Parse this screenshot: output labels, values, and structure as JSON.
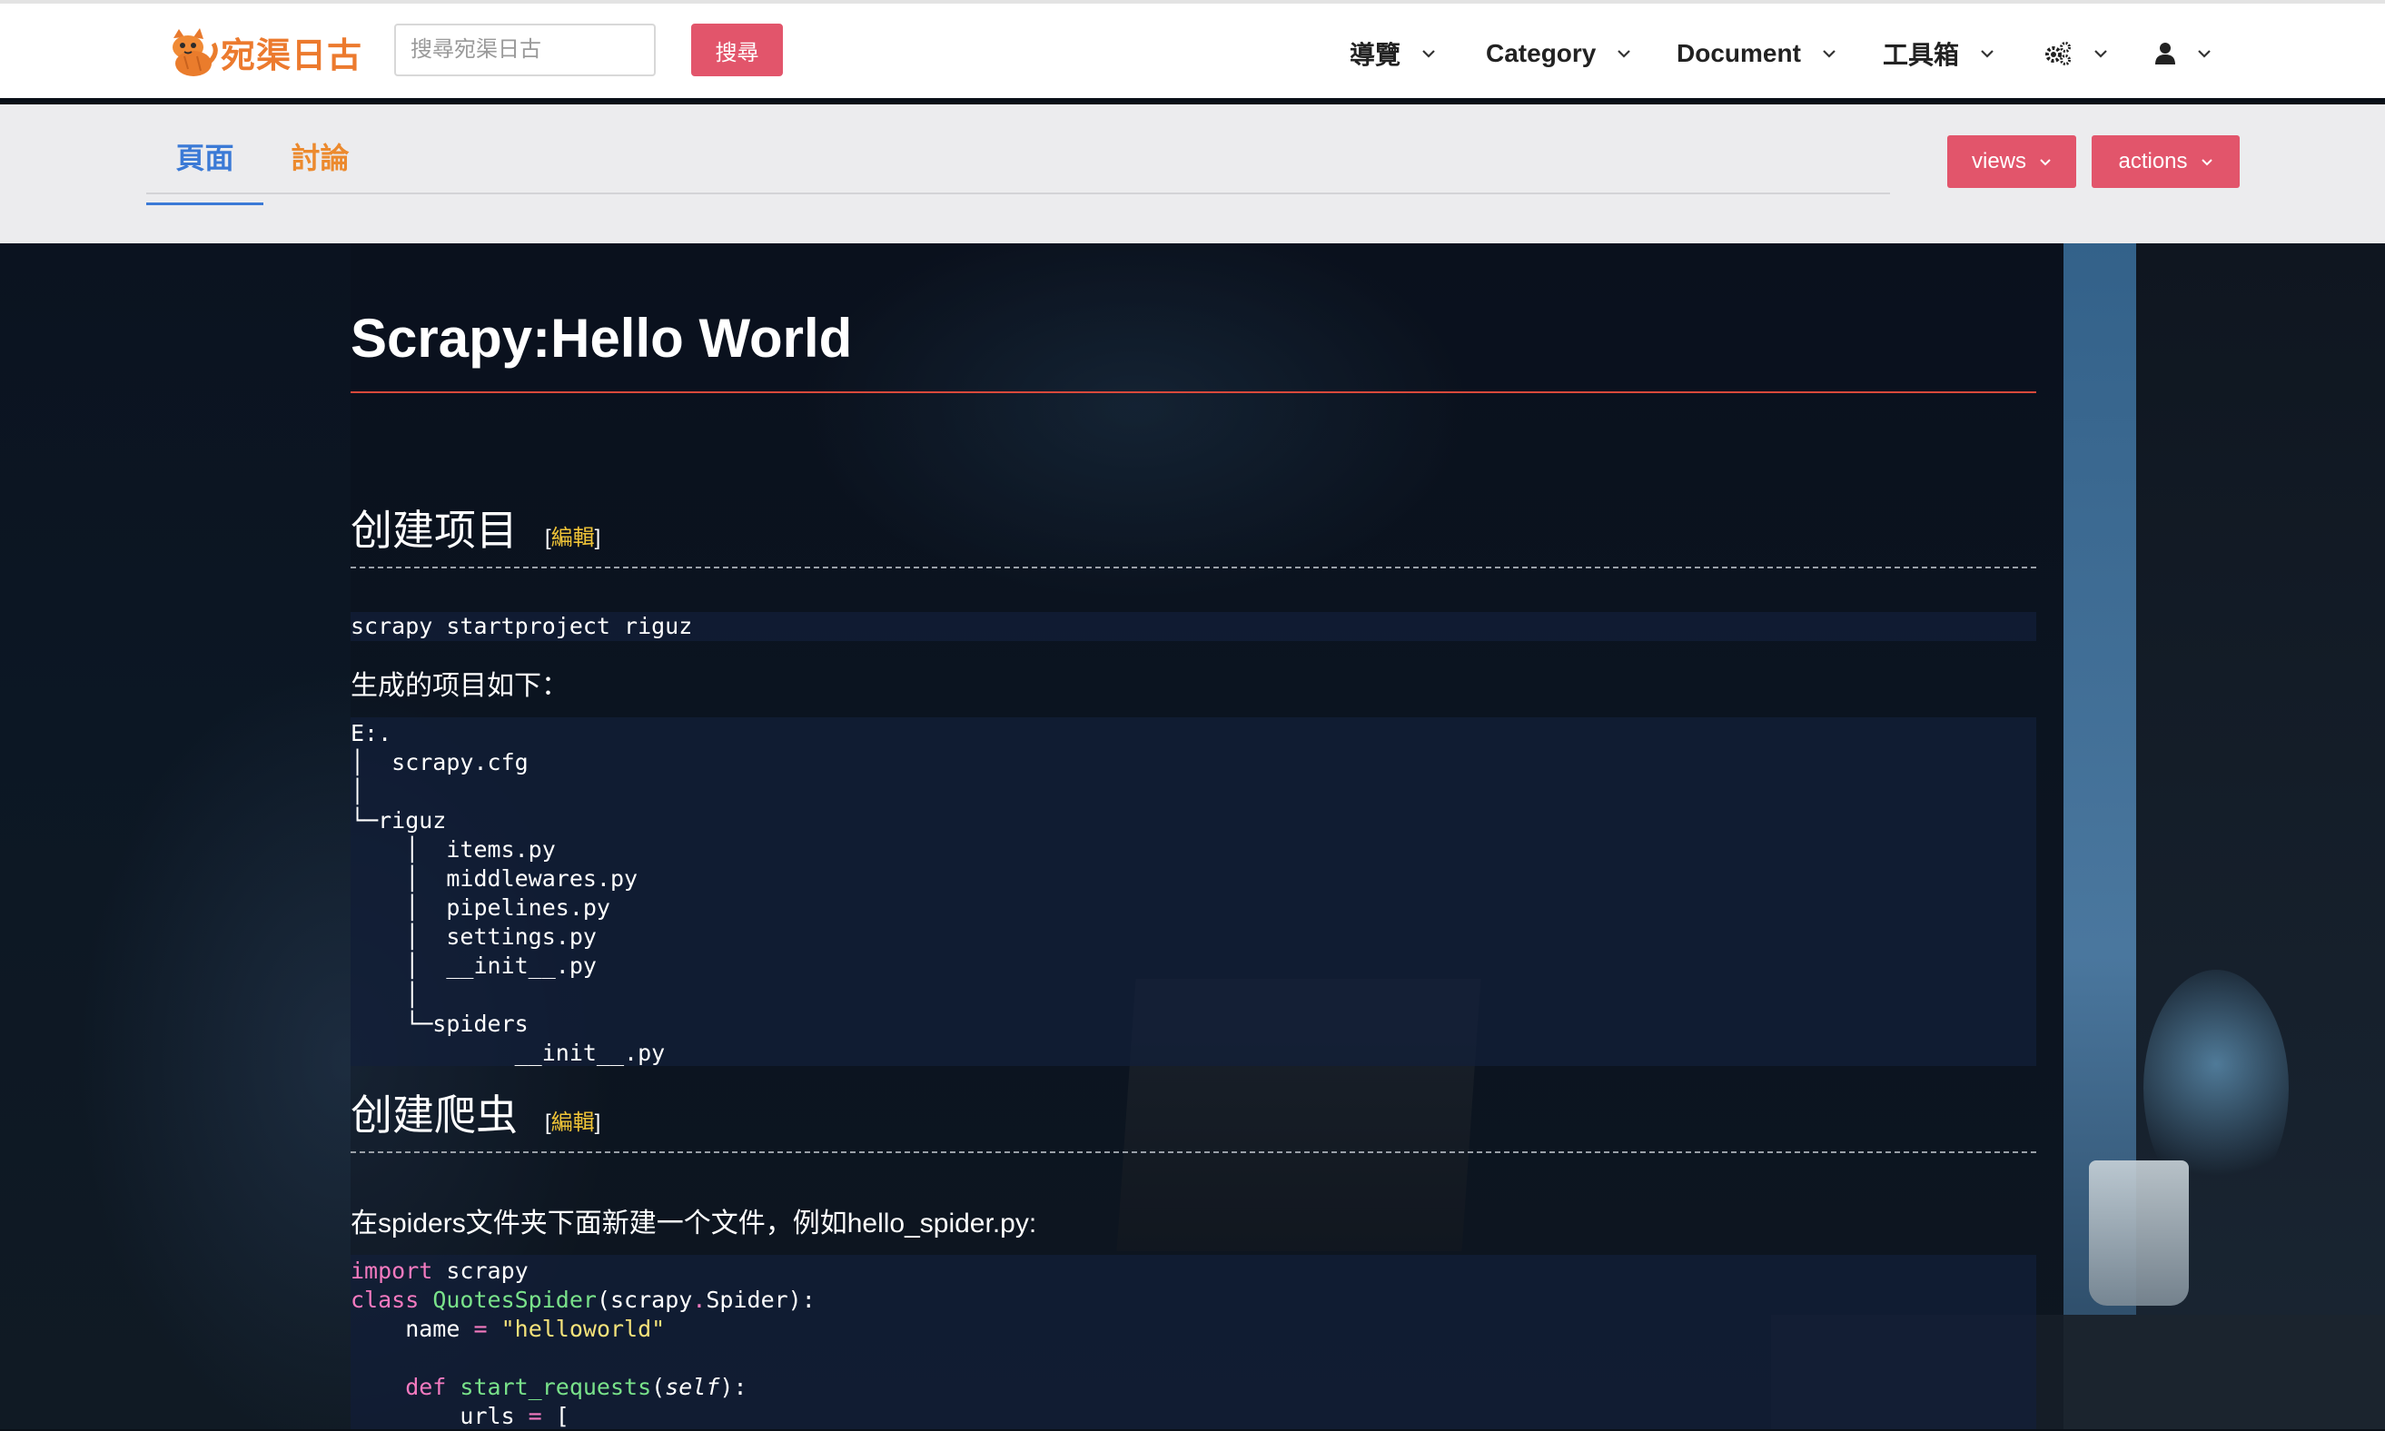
{
  "header": {
    "logo_text": "宛渠日古",
    "search_placeholder": "搜尋宛渠日古",
    "search_button": "搜尋",
    "nav": {
      "guide": "導覽",
      "category": "Category",
      "document": "Document",
      "tools": "工具箱",
      "settings_icon": "gears-icon",
      "user_icon": "user-icon"
    }
  },
  "subnav": {
    "tab_page": "頁面",
    "tab_discussion": "討論",
    "views_button": "views",
    "actions_button": "actions"
  },
  "article": {
    "title": "Scrapy:Hello World",
    "section1": {
      "heading": "创建项目",
      "edit_open": "[",
      "edit_label": "編輯",
      "edit_close": "]",
      "command": "scrapy startproject riguz",
      "text": "生成的项目如下：",
      "tree": [
        "E:.",
        "│  scrapy.cfg",
        "│",
        "└─riguz",
        "    │  items.py",
        "    │  middlewares.py",
        "    │  pipelines.py",
        "    │  settings.py",
        "    │  __init__.py",
        "    │",
        "    └─spiders",
        "            __init__.py"
      ]
    },
    "section2": {
      "heading": "创建爬虫",
      "edit_open": "[",
      "edit_label": "編輯",
      "edit_close": "]",
      "text": "在spiders文件夹下面新建一个文件，例如hello_spider.py:",
      "code": {
        "l1_kw": "import",
        "l1_rest": " scrapy",
        "l2_kw": "class",
        "l2_cls": "QuotesSpider",
        "l2_a": "(scrapy",
        "l2_dot": ".",
        "l2_b": "Spider):",
        "l3_a": "    name ",
        "l3_op": "=",
        "l3_str": "\"helloworld\"",
        "l5_kw": "    def",
        "l5_fn": "start_requests",
        "l5_a": "(",
        "l5_self": "self",
        "l5_b": "):",
        "l6_a": "        urls ",
        "l6_op": "=",
        "l6_b": " ["
      }
    }
  }
}
